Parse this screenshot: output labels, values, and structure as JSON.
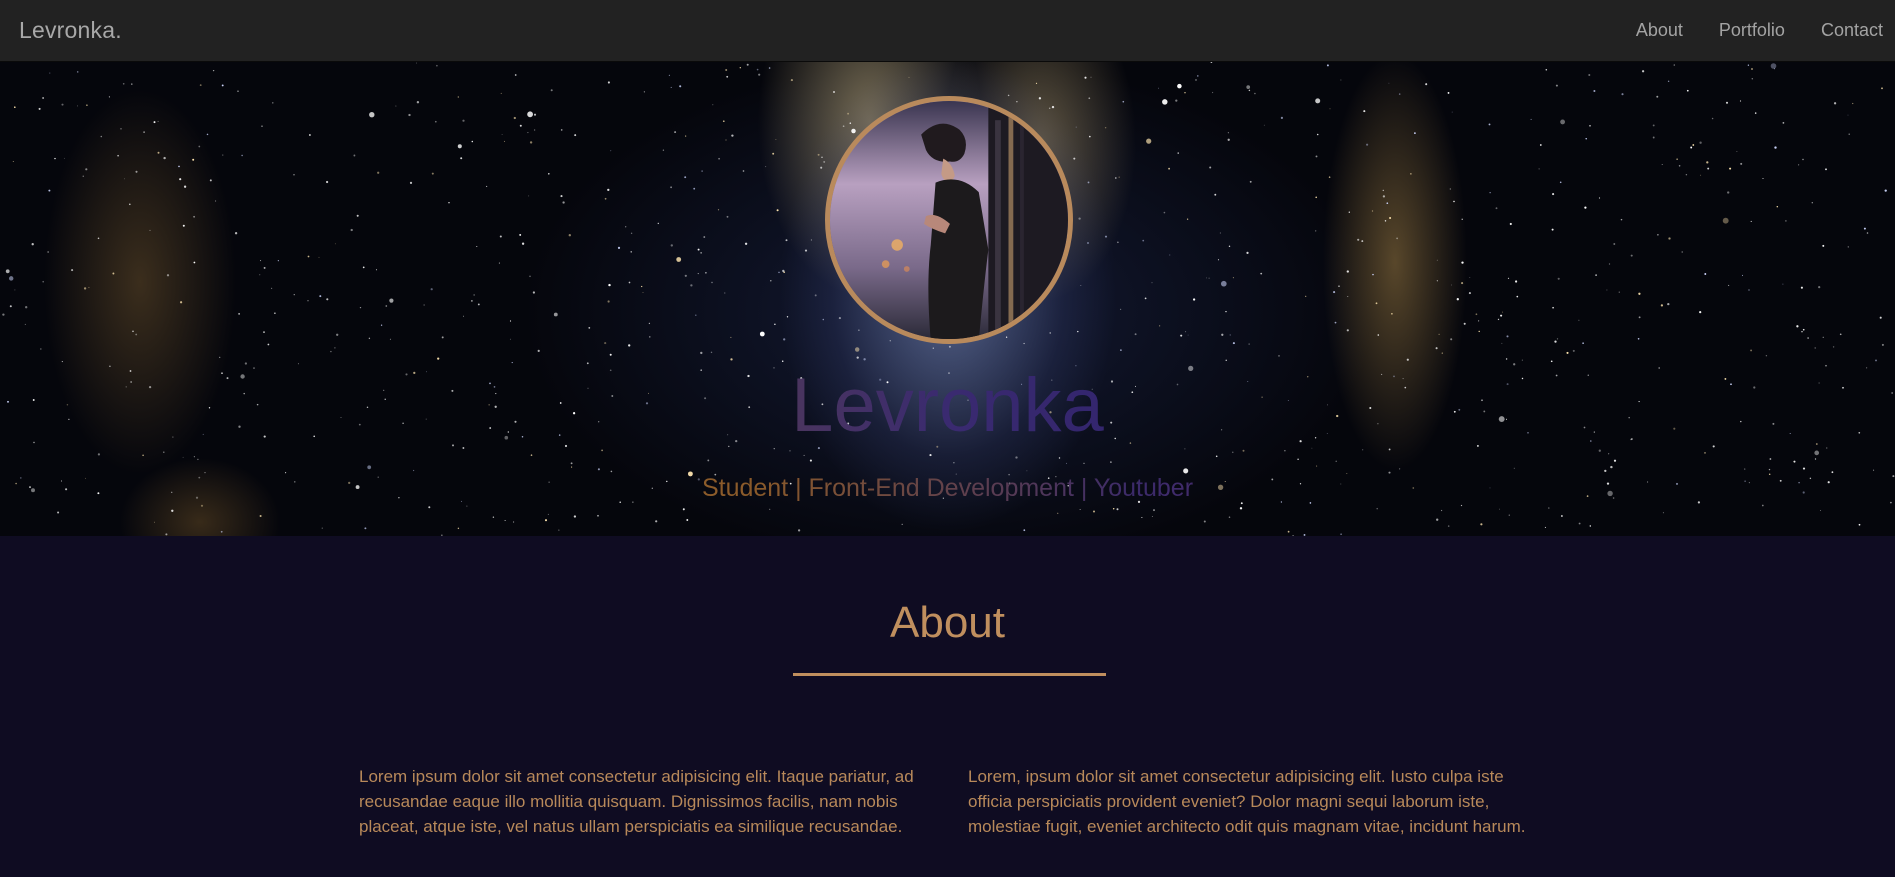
{
  "navbar": {
    "brand": "Levronka.",
    "links": [
      {
        "label": "About"
      },
      {
        "label": "Portfolio"
      },
      {
        "label": "Contact"
      }
    ]
  },
  "hero": {
    "avatar_icon": "profile-photo",
    "title": "Levronka",
    "subtitle": "Student | Front-End Development | Youtuber"
  },
  "about": {
    "title": "About",
    "paragraphs": [
      "Lorem ipsum dolor sit amet consectetur adipisicing elit. Itaque pariatur, ad recusandae eaque illo mollitia quisquam. Dignissimos facilis, nam nobis placeat, atque iste, vel natus ullam perspiciatis ea similique recusandae.",
      "Lorem, ipsum dolor sit amet consectetur adipisicing elit. Iusto culpa iste officia perspiciatis provident eveniet? Dolor magni sequi laborum iste, molestiae fugit, eveniet architecto odit quis magnam vitae, incidunt harum."
    ]
  },
  "colors": {
    "navbar_bg": "#222222",
    "accent": "#c08f5e",
    "page_bg": "#0f0c22"
  }
}
